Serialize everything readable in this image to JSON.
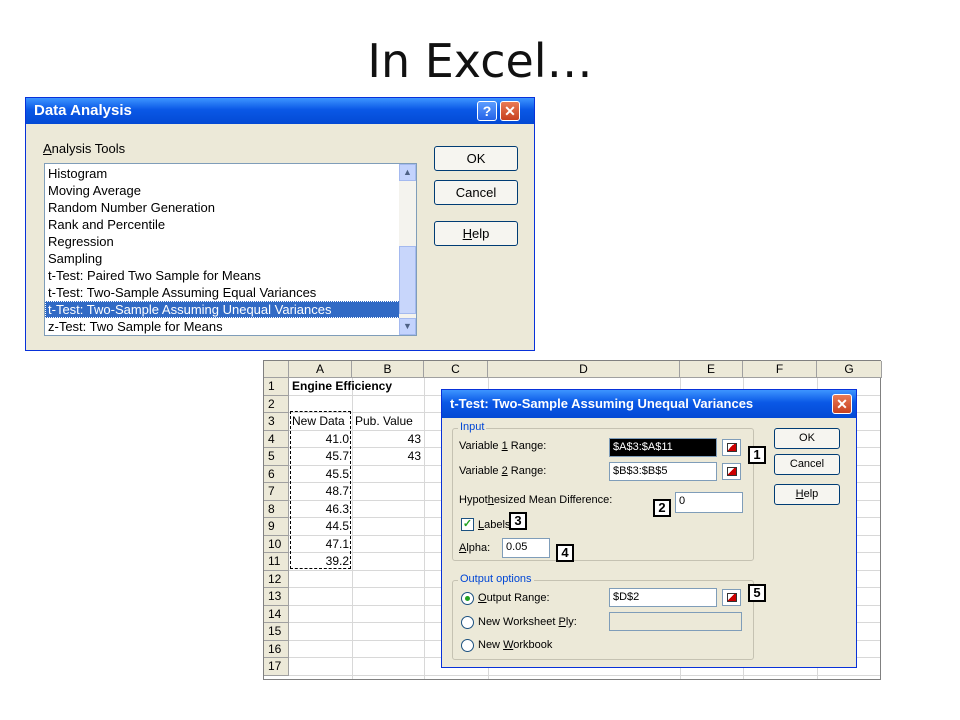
{
  "slide": {
    "title": "In Excel…"
  },
  "data_analysis": {
    "title": "Data Analysis",
    "tools_label_pre": "",
    "tools_label_u": "A",
    "tools_label_post": "nalysis Tools",
    "items": [
      "Histogram",
      "Moving Average",
      "Random Number Generation",
      "Rank and Percentile",
      "Regression",
      "Sampling",
      "t-Test: Paired Two Sample for Means",
      "t-Test: Two-Sample Assuming Equal Variances",
      "t-Test: Two-Sample Assuming Unequal Variances",
      "z-Test: Two Sample for Means"
    ],
    "selected_index": 8,
    "ok": "OK",
    "cancel": "Cancel",
    "help_u": "H",
    "help_rest": "elp",
    "help_glyph": "?",
    "close_glyph": "✕"
  },
  "sheet": {
    "columns": [
      "A",
      "B",
      "C",
      "D",
      "E",
      "F",
      "G"
    ],
    "rows": [
      "1",
      "2",
      "3",
      "4",
      "5",
      "6",
      "7",
      "8",
      "9",
      "10",
      "11",
      "12",
      "13",
      "14",
      "15",
      "16",
      "17"
    ],
    "title_cell": "Engine Efficiency",
    "header_a": "New Data",
    "header_b": "Pub. Value",
    "col_a": [
      "41.0",
      "45.7",
      "45.5",
      "48.7",
      "46.3",
      "44.5",
      "47.1",
      "39.2"
    ],
    "col_b": [
      "43",
      "43"
    ]
  },
  "ttest": {
    "title": "t-Test: Two-Sample Assuming Unequal Variances",
    "close_glyph": "✕",
    "input_group": "Input",
    "var1_label_pre": "Variable ",
    "var1_label_u": "1",
    "var1_label_post": " Range:",
    "var1_value": "$A$3:$A$11",
    "var2_label_pre": "Variable ",
    "var2_label_u": "2",
    "var2_label_post": " Range:",
    "var2_value": "$B$3:$B$5",
    "hyp_label_pre": "Hypot",
    "hyp_label_u": "h",
    "hyp_label_post": "esized Mean Difference:",
    "hyp_value": "0",
    "labels_u": "L",
    "labels_rest": "abels",
    "alpha_u": "A",
    "alpha_rest": "lpha:",
    "alpha_value": "0.05",
    "output_group": "Output options",
    "out_range_u": "O",
    "out_range_rest": "utput Range:",
    "out_range_value": "$D$2",
    "new_ws_pre": "New Worksheet ",
    "new_ws_u": "P",
    "new_ws_post": "ly:",
    "new_wb_pre": "New ",
    "new_wb_u": "W",
    "new_wb_post": "orkbook",
    "ok": "OK",
    "cancel": "Cancel",
    "help_u": "H",
    "help_rest": "elp",
    "check_glyph": "✓"
  },
  "callouts": [
    "1",
    "2",
    "3",
    "4",
    "5"
  ]
}
